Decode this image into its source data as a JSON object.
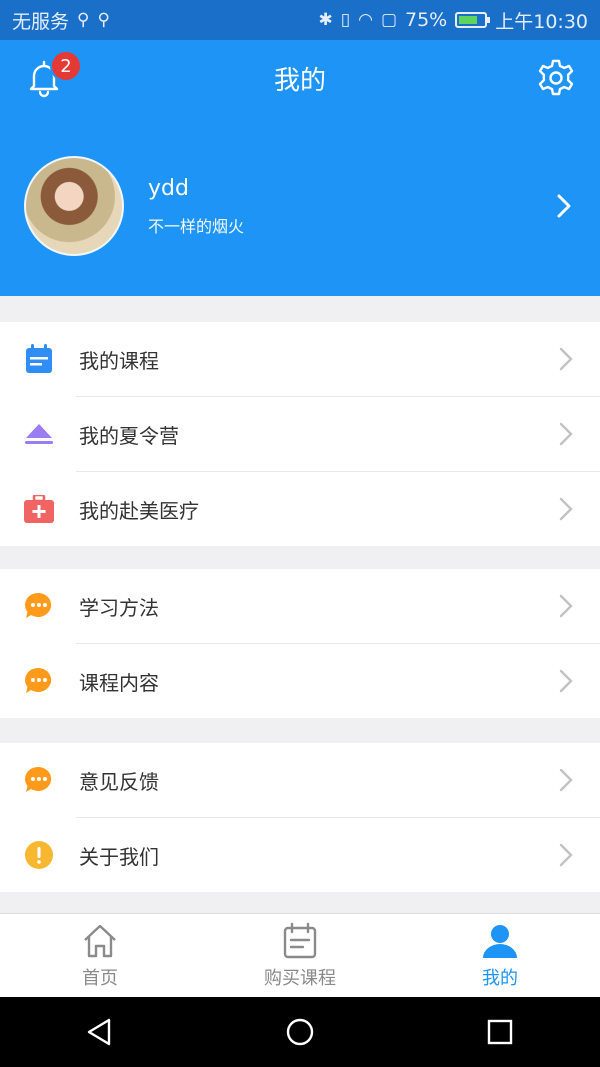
{
  "status_bar": {
    "carrier": "无服务",
    "battery": "75%",
    "time": "上午10:30"
  },
  "header": {
    "title": "我的",
    "notification_count": "2"
  },
  "profile": {
    "name": "ydd",
    "signature": "不一样的烟火"
  },
  "groups": [
    {
      "items": [
        {
          "label": "我的课程",
          "icon": "calendar-icon",
          "color": "#2f8df5"
        },
        {
          "label": "我的夏令营",
          "icon": "tent-icon",
          "color": "#9b7cf2"
        },
        {
          "label": "我的赴美医疗",
          "icon": "medical-kit-icon",
          "color": "#f06464"
        }
      ]
    },
    {
      "items": [
        {
          "label": "学习方法",
          "icon": "chat-bubble-icon",
          "color": "#ff9a1a"
        },
        {
          "label": "课程内容",
          "icon": "chat-bubble-icon",
          "color": "#ff9a1a"
        }
      ]
    },
    {
      "items": [
        {
          "label": "意见反馈",
          "icon": "chat-bubble-icon",
          "color": "#ff9a1a"
        },
        {
          "label": "关于我们",
          "icon": "info-icon",
          "color": "#f7b731"
        }
      ]
    }
  ],
  "tabs": [
    {
      "label": "首页",
      "icon": "home-icon"
    },
    {
      "label": "购买课程",
      "icon": "calendar-icon"
    },
    {
      "label": "我的",
      "icon": "user-icon",
      "active": true
    }
  ],
  "colors": {
    "primary": "#1e94f6",
    "status_bar": "#1a6fc9",
    "background": "#f0f0f3"
  }
}
